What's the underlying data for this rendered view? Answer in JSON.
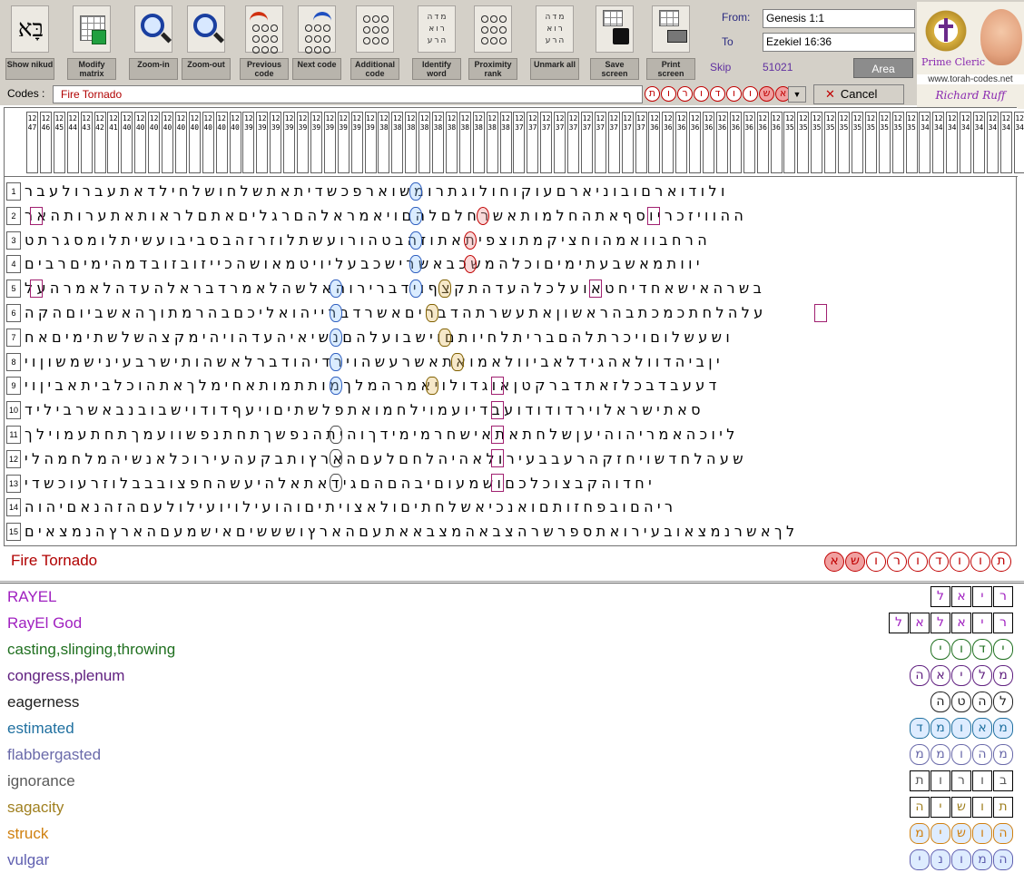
{
  "toolbar": {
    "tools": [
      {
        "id": "show-nikud",
        "label": "Show nikud",
        "icon": "hebrew-glyph-icon",
        "glyph": "בָּא"
      },
      {
        "id": "modify-matrix",
        "label": "Modify matrix",
        "icon": "grid-modify-icon"
      },
      {
        "id": "zoom-in",
        "label": "Zoom-in",
        "icon": "zoom-in-icon"
      },
      {
        "id": "zoom-out",
        "label": "Zoom-out",
        "icon": "zoom-out-icon"
      },
      {
        "id": "previous-code",
        "label": "Previous code",
        "icon": "previous-arrow-icon"
      },
      {
        "id": "next-code",
        "label": "Next code",
        "icon": "next-arrow-icon"
      },
      {
        "id": "additional-code",
        "label": "Additional code",
        "icon": "additional-code-icon"
      },
      {
        "id": "identify-word",
        "label": "Identify word",
        "icon": "identify-word-icon"
      },
      {
        "id": "proximity-rank",
        "label": "Proximity rank",
        "icon": "proximity-icon"
      },
      {
        "id": "unmark-all",
        "label": "Unmark all",
        "icon": "unmark-icon"
      },
      {
        "id": "save-screen",
        "label": "Save screen",
        "icon": "floppy-icon"
      },
      {
        "id": "print-screen",
        "label": "Print screen",
        "icon": "printer-icon"
      }
    ],
    "from_label": "From:",
    "from_value": "Genesis 1:1",
    "to_label": "To",
    "to_value": "Ezekiel 16:36",
    "skip_label": "Skip",
    "skip_value": "51021",
    "area_label": "Area"
  },
  "logo": {
    "title": "Prime Cleric",
    "url": "www.torah-codes.net",
    "signature": "Richard Ruff"
  },
  "codes": {
    "label": "Codes :",
    "value": "Fire Tornado",
    "sequence": [
      "ת",
      "ו",
      "ר",
      "ו",
      "ד",
      "ו",
      "ו",
      "ש",
      "א"
    ],
    "cancel_label": "Cancel"
  },
  "matrix": {
    "column_headers": [
      "1247",
      "1246",
      "1245",
      "1244",
      "1243",
      "1242",
      "1241",
      "1240",
      "1240",
      "1240",
      "1240",
      "1240",
      "1240",
      "1240",
      "1240",
      "1240",
      "1239",
      "1239",
      "1239",
      "1239",
      "1239",
      "1239",
      "1239",
      "1239",
      "1239",
      "1239",
      "1238",
      "1238",
      "1238",
      "1238",
      "1238",
      "1238",
      "1238",
      "1238",
      "1238",
      "1238",
      "1237",
      "1237",
      "1237",
      "1237",
      "1237",
      "1237",
      "1237",
      "1237",
      "1237",
      "1237",
      "1236",
      "1236",
      "1236",
      "1236",
      "1236",
      "1236",
      "1236",
      "1236",
      "1236",
      "1236",
      "1235",
      "1235",
      "1235",
      "1235",
      "1235",
      "1235",
      "1235",
      "1235",
      "1235",
      "1235",
      "1234",
      "1234",
      "1234",
      "1234",
      "1234",
      "1234",
      "1234",
      "1234"
    ],
    "rows": [
      {
        "n": "1",
        "text": "ולודוארםובוניארםעוקוחולוגתרומשוארפכשדיתאתשלחושלחילדאתעברולעבר"
      },
      {
        "n": "2",
        "text": "ההוויזכריוסףאתהחלמותאשרחלםלהםויאמראלהםרגליםאתםלראותאתערותהאר"
      },
      {
        "n": "3",
        "text": "הרחבוואמהוחציקמתוצפיתאתוזהבטהורועשתלוזרזהבסביבועשיתלומסגרתט"
      },
      {
        "n": "4",
        "text": "יוותמאשבעתימיםוכלהמשכבאשרישכבעליויטמאושהכייזובזובדמהימיםרבים"
      },
      {
        "n": "5",
        "text": "בשרהאישאחדיחטאועלכלהעדהתקצףוידברירוהאלשהלאמרדבראלהעדהלאמרהעל"
      },
      {
        "n": "6",
        "text": "עלהלחתכמכתבהראשוןאתעשרתהדבריםאשרדברייהואליכםבהרמתוךהאשביוםהקה"
      },
      {
        "n": "7",
        "text": "ושעשלוםויכרתלהםבריתלחיותםוישבועלהםנשיאיהעדהויהימקצהשלשתימיםאח"
      },
      {
        "n": "8",
        "text": "יןביהדוולאהגידלאביוולאמואתאשרעשהוירדיהודברלאשהותישרבעינישמשוןוי"
      },
      {
        "n": "9",
        "text": "דעעבדבכלזאתדברקטןאוגדולויאמרהמלךמותתמותאחימלךאתהוכלביתאביןוי"
      },
      {
        "n": "10",
        "text": "סאתישראלוירדודודועבדיועמוילחמואתפלשתיםויעףדודוישבובנבאשרביליד"
      },
      {
        "n": "11",
        "text": "ליוכהאמריהוהיעןשלחתאתאישחרמימידךוהיתהנפשךתחתנפשוועמךתחתעמוילך"
      },
      {
        "n": "12",
        "text": "שעהלחדשויחזקהרעבבעירולאהיהלחםלעםהארץותבקעהעירוכלאנשיהמלחמהלי"
      },
      {
        "n": "13",
        "text": "יחדוהקבצוכלכםושמעוםיבהםהםגידאתאלהיעשהחפצובבבלוזרעוכשדי"
      },
      {
        "n": "14",
        "text": "ריהםובפחזותםואנכיאשלחתיםולאצויתיםוהועילויועילולעםהזהנאםיהוה"
      },
      {
        "n": "15",
        "text": "לךאשרנמצאובעירואתספרשרהצבאהמצבאאתעםהארץושששיםאישמעםהארץהנמצאים"
      }
    ]
  },
  "result": {
    "title": "Fire Tornado",
    "sequence": [
      "א",
      "ש",
      "ו",
      "ר",
      "ו",
      "ד",
      "ו",
      "ו",
      "ת"
    ]
  },
  "legend": [
    {
      "term": "RAYEL",
      "color": "#a020c0",
      "letters": [
        "ר",
        "י",
        "א",
        "ל"
      ],
      "style": "box"
    },
    {
      "term": "RayEl God",
      "color": "#a020c0",
      "letters": [
        "ר",
        "י",
        "א",
        "ל",
        "א",
        "ל"
      ],
      "style": "box"
    },
    {
      "term": "casting,slinging,throwing",
      "color": "#207020",
      "letters": [
        "י",
        "ד",
        "ו",
        "י"
      ],
      "style": "oval"
    },
    {
      "term": "congress,plenum",
      "color": "#602080",
      "letters": [
        "מ",
        "ל",
        "י",
        "א",
        "ה"
      ],
      "style": "oval"
    },
    {
      "term": "eagerness",
      "color": "#202020",
      "letters": [
        "ל",
        "ה",
        "ט",
        "ה"
      ],
      "style": "oval"
    },
    {
      "term": "estimated",
      "color": "#2070a0",
      "letters": [
        "מ",
        "א",
        "ו",
        "מ",
        "ד"
      ],
      "style": "hex"
    },
    {
      "term": "flabbergasted",
      "color": "#6a6aaa",
      "letters": [
        "מ",
        "ה",
        "ו",
        "מ",
        "מ"
      ],
      "style": "oval"
    },
    {
      "term": "ignorance",
      "color": "#5a5a5a",
      "letters": [
        "ב",
        "ו",
        "ר",
        "ו",
        "ת"
      ],
      "style": "box"
    },
    {
      "term": "sagacity",
      "color": "#a08020",
      "letters": [
        "ת",
        "ו",
        "ש",
        "י",
        "ה"
      ],
      "style": "box"
    },
    {
      "term": "struck",
      "color": "#d08010",
      "letters": [
        "ה",
        "ו",
        "ש",
        "י",
        "מ"
      ],
      "style": "hex"
    },
    {
      "term": "vulgar",
      "color": "#6060b0",
      "letters": [
        "ה",
        "מ",
        "ו",
        "נ",
        "י"
      ],
      "style": "hex"
    }
  ]
}
